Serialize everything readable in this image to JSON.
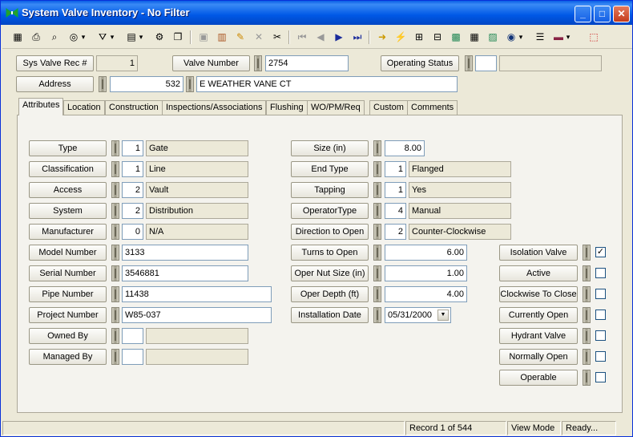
{
  "window": {
    "title": "System Valve Inventory - No Filter",
    "min": "_",
    "max": "□",
    "close": "✕"
  },
  "toolbar": {
    "icons": [
      "grid-icon",
      "print-icon",
      "preview-icon",
      "binoculars-icon",
      "filter-icon",
      "form-icon",
      "properties-icon",
      "copy-icon",
      "save-icon",
      "books-icon",
      "pencil-icon",
      "delete-icon",
      "scissors-icon",
      "first-record-icon",
      "prev-record-icon",
      "next-record-icon",
      "last-record-icon",
      "goto-icon",
      "lightning-icon",
      "tree-icon",
      "relate-icon",
      "map-icon",
      "calculator-icon",
      "photo-icon",
      "globe-icon",
      "list-icon",
      "library-icon",
      "exit-icon"
    ],
    "glyphs": [
      "▦",
      "⎙",
      "⌕",
      "◎",
      "⛛",
      "▤",
      "⚙",
      "❐",
      "▣",
      "▥",
      "✎",
      "✕",
      "✂",
      "⏮",
      "◀",
      "▶",
      "⏭",
      "➜",
      "⚡",
      "⊞",
      "⊟",
      "▩",
      "▦",
      "▨",
      "◉",
      "☰",
      "▬",
      "⬚"
    ],
    "more": "▾"
  },
  "header": {
    "rec_label": "Sys Valve Rec #",
    "rec_value": "1",
    "valve_label": "Valve Number",
    "valve_value": "2754",
    "status_label": "Operating Status",
    "status_code": "",
    "status_desc": "",
    "address_label": "Address",
    "address_num": "532",
    "address_street": "E WEATHER VANE CT"
  },
  "tabs": [
    "Attributes",
    "Location",
    "Construction",
    "Inspections/Associations",
    "Flushing",
    "WO/PM/Req",
    "Custom",
    "Comments"
  ],
  "left": [
    {
      "label": "Type",
      "code": "1",
      "desc": "Gate"
    },
    {
      "label": "Classification",
      "code": "1",
      "desc": "Line"
    },
    {
      "label": "Access",
      "code": "2",
      "desc": "Vault"
    },
    {
      "label": "System",
      "code": "2",
      "desc": "Distribution"
    },
    {
      "label": "Manufacturer",
      "code": "0",
      "desc": "N/A"
    }
  ],
  "left_text": [
    {
      "label": "Model Number",
      "value": "3133"
    },
    {
      "label": "Serial Number",
      "value": "3546881"
    },
    {
      "label": "Pipe Number",
      "value": "11438"
    },
    {
      "label": "Project Number",
      "value": "W85-037"
    }
  ],
  "left_owned": [
    {
      "label": "Owned By",
      "code": "",
      "desc": ""
    },
    {
      "label": "Managed By",
      "code": "",
      "desc": ""
    }
  ],
  "mid_size": {
    "label": "Size (in)",
    "value": "8.00"
  },
  "mid": [
    {
      "label": "End Type",
      "code": "1",
      "desc": "Flanged"
    },
    {
      "label": "Tapping",
      "code": "1",
      "desc": "Yes"
    },
    {
      "label": "OperatorType",
      "code": "4",
      "desc": "Manual"
    },
    {
      "label": "Direction to Open",
      "code": "2",
      "desc": "Counter-Clockwise"
    }
  ],
  "mid_num": [
    {
      "label": "Turns to Open",
      "value": "6.00"
    },
    {
      "label": "Oper Nut Size (in)",
      "value": "1.00"
    },
    {
      "label": "Oper Depth (ft)",
      "value": "4.00"
    }
  ],
  "install": {
    "label": "Installation Date",
    "value": "05/31/2000",
    "arrow": "▼"
  },
  "checks": [
    {
      "label": "Isolation Valve",
      "mark": "✓"
    },
    {
      "label": "Active",
      "mark": ""
    },
    {
      "label": "Clockwise To Close",
      "mark": ""
    },
    {
      "label": "Currently Open",
      "mark": ""
    },
    {
      "label": "Hydrant Valve",
      "mark": ""
    },
    {
      "label": "Normally Open",
      "mark": ""
    },
    {
      "label": "Operable",
      "mark": ""
    }
  ],
  "status": {
    "record": "Record 1 of 544",
    "mode": "View Mode",
    "state": "Ready..."
  }
}
